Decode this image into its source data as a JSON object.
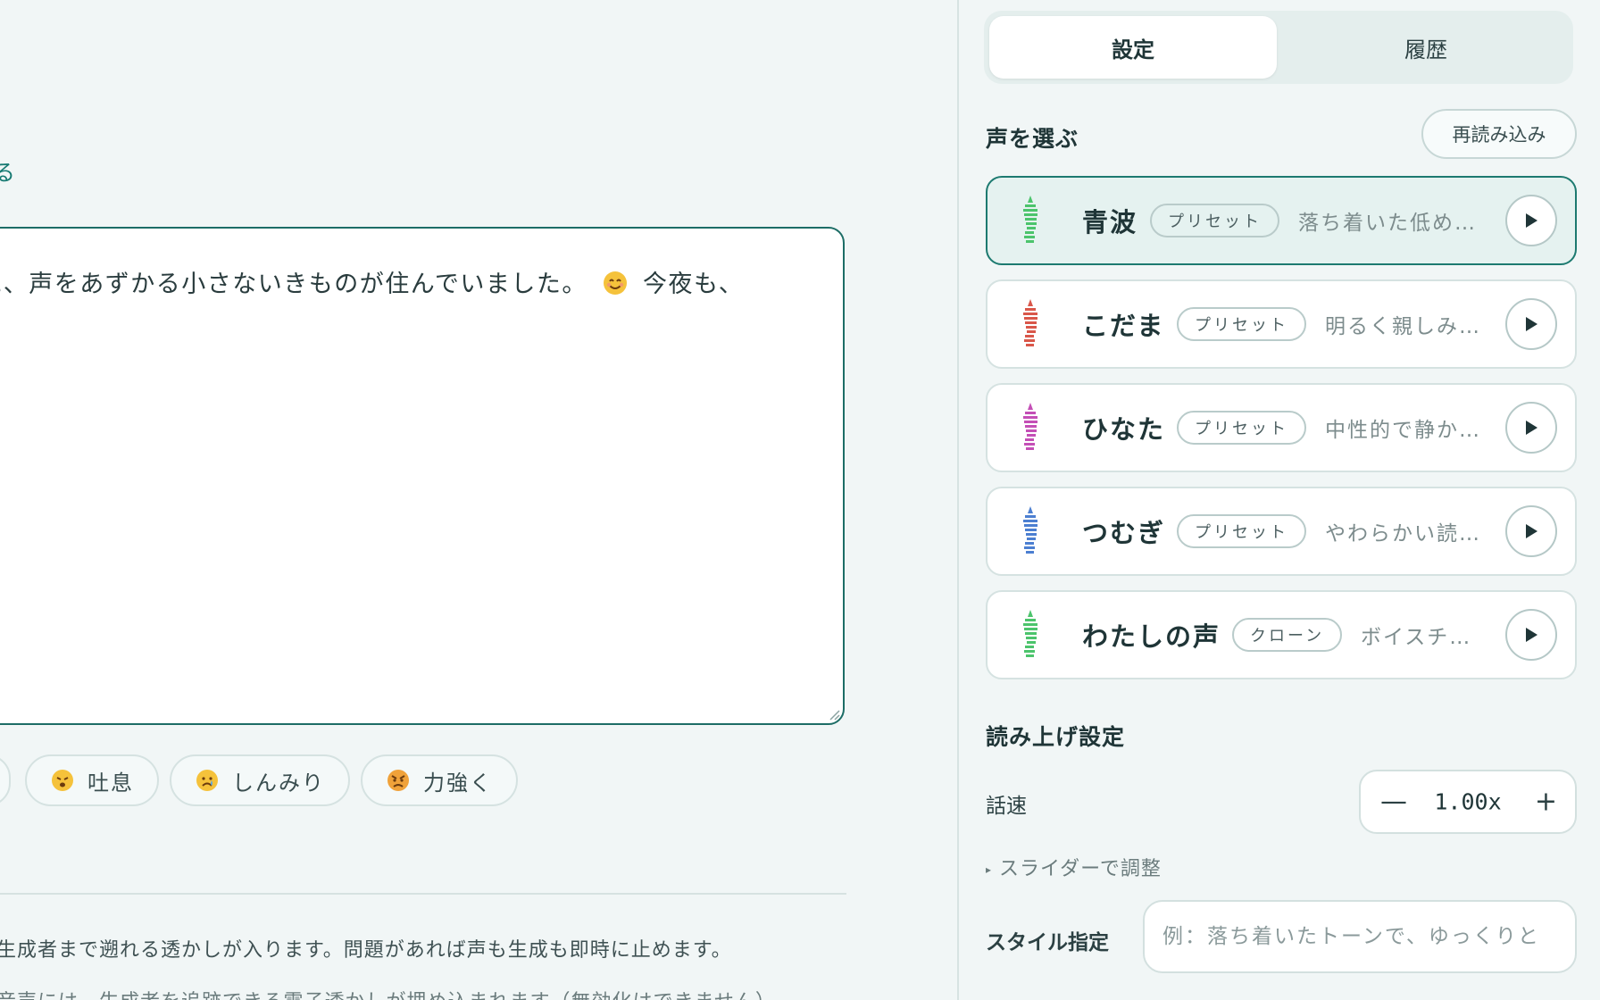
{
  "main": {
    "link_text": "る",
    "editor_text": "に、声をあずかる小さないきものが住んでいました。",
    "editor_text_tail": "今夜も、",
    "chips": [
      {
        "label": "吐息",
        "emoji": "sigh"
      },
      {
        "label": "しんみり",
        "emoji": "sad"
      },
      {
        "label": "力強く",
        "emoji": "angry"
      }
    ],
    "note1": "生成者まで遡れる透かしが入ります。問題があれば声も生成も即時に止めます。",
    "note2": "音声には、生成者を追跡できる電子透かしが埋め込まれます（無効化はできません）"
  },
  "sidebar": {
    "tabs": [
      {
        "label": "設定",
        "active": true
      },
      {
        "label": "履歴",
        "active": false
      }
    ],
    "voice_section_title": "声を選ぶ",
    "reload_label": "再読み込み",
    "voices": [
      {
        "name": "青波",
        "badge": "プリセット",
        "desc": "落ち着いた低め…",
        "color": "#4cc46c",
        "selected": true
      },
      {
        "name": "こだま",
        "badge": "プリセット",
        "desc": "明るく親しみ…",
        "color": "#d9574a",
        "selected": false
      },
      {
        "name": "ひなた",
        "badge": "プリセット",
        "desc": "中性的で静か…",
        "color": "#c44fb6",
        "selected": false
      },
      {
        "name": "つむぎ",
        "badge": "プリセット",
        "desc": "やわらかい読…",
        "color": "#4c7fd1",
        "selected": false
      },
      {
        "name": "わたしの声",
        "badge": "クローン",
        "desc": "ボイスチ…",
        "color": "#4cc46c",
        "selected": false
      }
    ],
    "reading_section_title": "読み上げ設定",
    "speed": {
      "label": "話速",
      "value": "1.00x",
      "minus": "—",
      "plus": "+"
    },
    "slider_toggle": "スライダーで調整",
    "style": {
      "label": "スタイル指定",
      "placeholder": "例：落ち着いたトーンで、ゆっくりと"
    }
  }
}
